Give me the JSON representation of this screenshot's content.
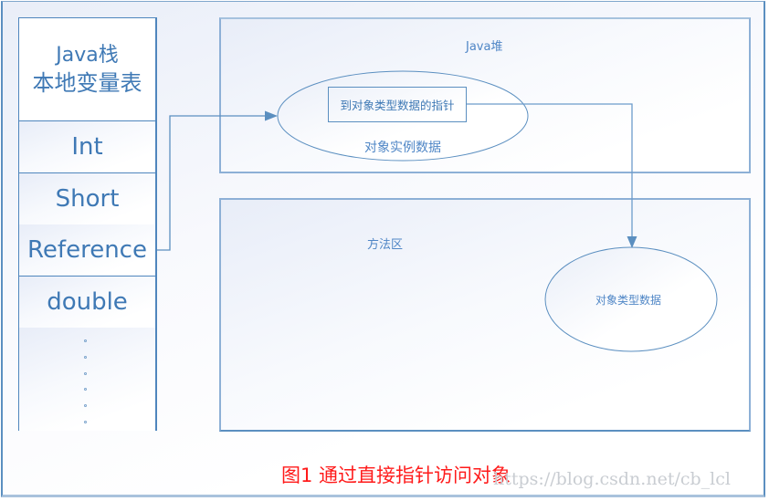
{
  "stack": {
    "title_line1": "Java栈",
    "title_line2": "本地变量表",
    "rows": [
      "Int",
      "Short",
      "Reference",
      "double"
    ],
    "ellipsis_dots": 6
  },
  "heap": {
    "title": "Java堆",
    "instance_ellipse_label": "对象实例数据",
    "pointer_box_label": "到对象类型数据的指针"
  },
  "method_area": {
    "title": "方法区",
    "type_ellipse_label": "对象类型数据"
  },
  "edges": [
    {
      "from": "Reference",
      "to": "对象实例数据",
      "arrow": true
    },
    {
      "from": "到对象类型数据的指针",
      "to": "对象类型数据",
      "arrow": true
    }
  ],
  "caption": "图1 通过直接指针访问对象",
  "watermark": "https://blog.csdn.net/cb_lcl",
  "colors": {
    "line": "#5b8fc0",
    "text": "#3f79b5",
    "caption": "#ff1a1a"
  }
}
